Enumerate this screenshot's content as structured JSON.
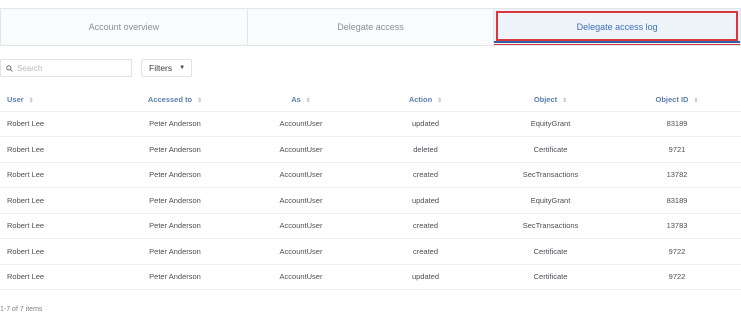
{
  "tabs": [
    {
      "label": "Account overview",
      "active": false
    },
    {
      "label": "Delegate access",
      "active": false
    },
    {
      "label": "Delegate access log",
      "active": true
    }
  ],
  "toolbar": {
    "search_placeholder": "Search",
    "filters_label": "Filters",
    "filters_caret": "▼",
    "sort_glyph": "⇕"
  },
  "table": {
    "columns": [
      "User",
      "Accessed to",
      "As",
      "Action",
      "Object",
      "Object ID"
    ],
    "rows": [
      [
        "Robert Lee",
        "Peter Anderson",
        "AccountUser",
        "updated",
        "EquityGrant",
        "83189"
      ],
      [
        "Robert Lee",
        "Peter Anderson",
        "AccountUser",
        "deleted",
        "Certificate",
        "9721"
      ],
      [
        "Robert Lee",
        "Peter Anderson",
        "AccountUser",
        "created",
        "SecTransactions",
        "13782"
      ],
      [
        "Robert Lee",
        "Peter Anderson",
        "AccountUser",
        "updated",
        "EquityGrant",
        "83189"
      ],
      [
        "Robert Lee",
        "Peter Anderson",
        "AccountUser",
        "created",
        "SecTransactions",
        "13783"
      ],
      [
        "Robert Lee",
        "Peter Anderson",
        "AccountUser",
        "created",
        "Certificate",
        "9722"
      ],
      [
        "Robert Lee",
        "Peter Anderson",
        "AccountUser",
        "updated",
        "Certificate",
        "9722"
      ]
    ]
  },
  "footer": {
    "pagination": "1-7 of 7 items"
  },
  "colors": {
    "accent": "#3f72b6",
    "highlight": "#d9363e"
  }
}
